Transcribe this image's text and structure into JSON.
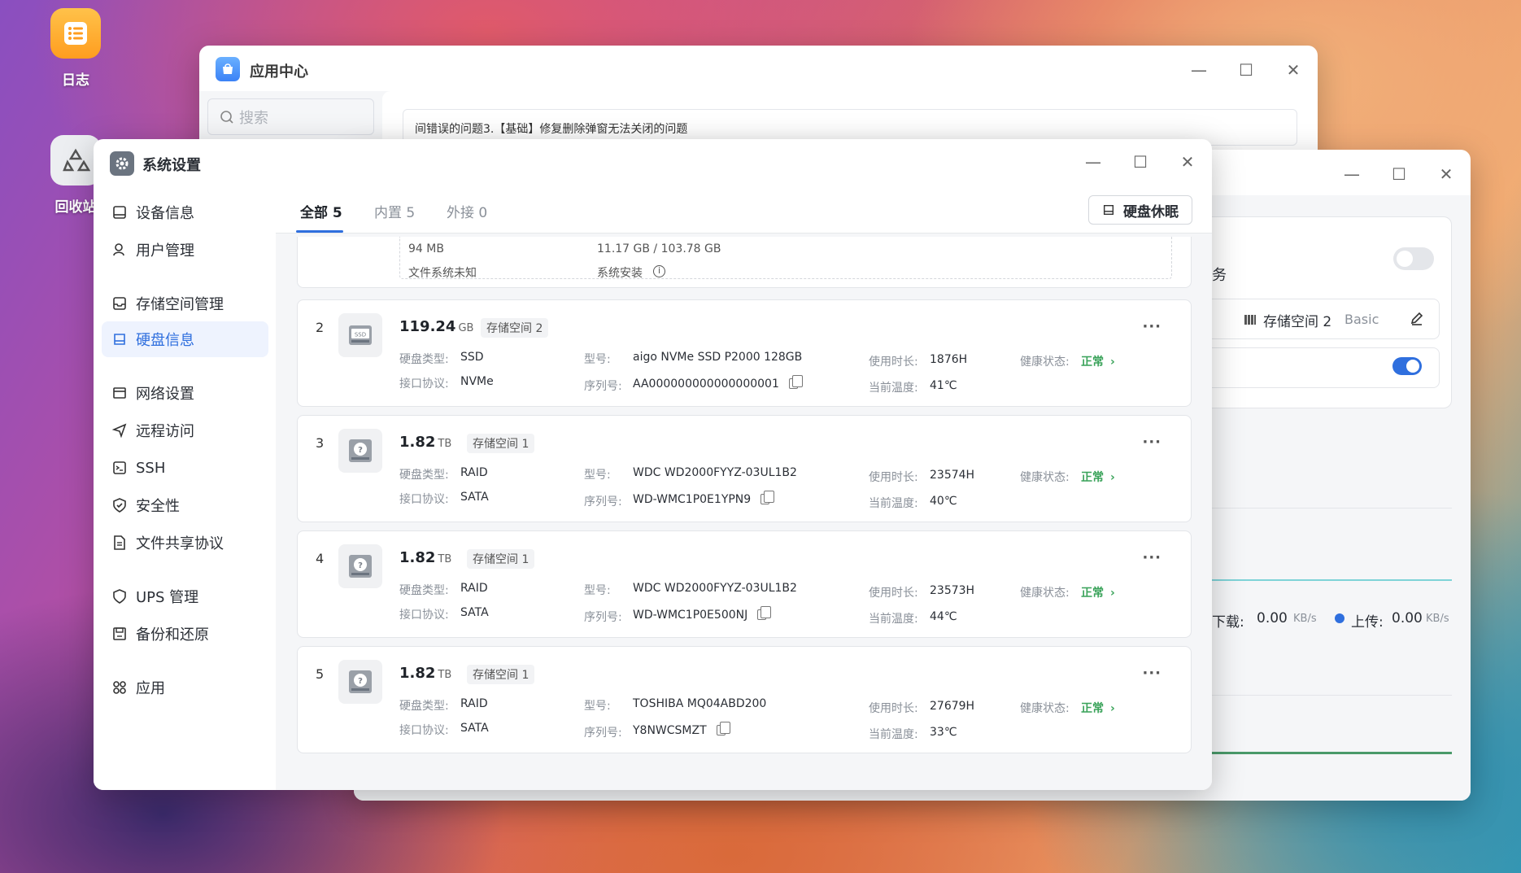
{
  "desktop": {
    "icons": [
      {
        "label": "日志"
      },
      {
        "label": "回收站"
      }
    ]
  },
  "app_center": {
    "title": "应用中心",
    "search_placeholder": "搜索",
    "notice": "间错误的问题3.【基础】修复删除弹窗无法关闭的问题"
  },
  "right_window": {
    "partial_label": "务",
    "storage_label": "存储空间 2",
    "storage_type": "Basic",
    "download_label": "下载:",
    "download_value": "0.00",
    "download_unit": "KB/s",
    "upload_label": "上传:",
    "upload_value": "0.00",
    "upload_unit": "KB/s"
  },
  "system_settings": {
    "title": "系统设置",
    "nav": [
      {
        "label": "设备信息",
        "icon": "device-icon"
      },
      {
        "label": "用户管理",
        "icon": "user-icon"
      },
      {
        "label": "存储空间管理",
        "icon": "storage-icon"
      },
      {
        "label": "硬盘信息",
        "icon": "disk-icon",
        "active": true
      },
      {
        "label": "网络设置",
        "icon": "network-icon"
      },
      {
        "label": "远程访问",
        "icon": "remote-icon"
      },
      {
        "label": "SSH",
        "icon": "ssh-icon"
      },
      {
        "label": "安全性",
        "icon": "shield-icon"
      },
      {
        "label": "文件共享协议",
        "icon": "file-share-icon"
      },
      {
        "label": "UPS 管理",
        "icon": "ups-icon"
      },
      {
        "label": "备份和还原",
        "icon": "backup-icon"
      },
      {
        "label": "应用",
        "icon": "apps-icon"
      }
    ],
    "tabs": [
      {
        "label": "全部 5",
        "active": true
      },
      {
        "label": "内置 5"
      },
      {
        "label": "外接 0"
      }
    ],
    "sleep_button": "硬盘休眠",
    "partition": {
      "size": "94 MB",
      "fs": "文件系统未知",
      "usage": "11.17 GB / 103.78 GB",
      "note": "系统安装"
    },
    "labels": {
      "type": "硬盘类型:",
      "protocol": "接口协议:",
      "model": "型号:",
      "serial": "序列号:",
      "hours": "使用时长:",
      "temp": "当前温度:",
      "health": "健康状态:"
    },
    "disks": [
      {
        "num": "2",
        "size": "119.24",
        "unit": "GB",
        "pool": "存储空间 2",
        "type": "SSD",
        "protocol": "NVMe",
        "model": "aigo NVMe SSD P2000 128GB",
        "serial": "AA000000000000000001",
        "hours": "1876H",
        "temp": "41℃",
        "health": "正常",
        "icon": "ssd-icon"
      },
      {
        "num": "3",
        "size": "1.82",
        "unit": "TB",
        "pool": "存储空间 1",
        "type": "RAID",
        "protocol": "SATA",
        "model": "WDC WD2000FYYZ-03UL1B2",
        "serial": "WD-WMC1P0E1YPN9",
        "hours": "23574H",
        "temp": "40℃",
        "health": "正常",
        "icon": "hdd-unknown-icon"
      },
      {
        "num": "4",
        "size": "1.82",
        "unit": "TB",
        "pool": "存储空间 1",
        "type": "RAID",
        "protocol": "SATA",
        "model": "WDC WD2000FYYZ-03UL1B2",
        "serial": "WD-WMC1P0E500NJ",
        "hours": "23573H",
        "temp": "44℃",
        "health": "正常",
        "icon": "hdd-unknown-icon"
      },
      {
        "num": "5",
        "size": "1.82",
        "unit": "TB",
        "pool": "存储空间 1",
        "type": "RAID",
        "protocol": "SATA",
        "model": "TOSHIBA MQ04ABD200",
        "serial": "Y8NWCSMZT",
        "hours": "27679H",
        "temp": "33℃",
        "health": "正常",
        "icon": "hdd-unknown-icon"
      }
    ]
  },
  "colors": {
    "accent": "#2f6fde",
    "ok": "#3aa35a"
  }
}
